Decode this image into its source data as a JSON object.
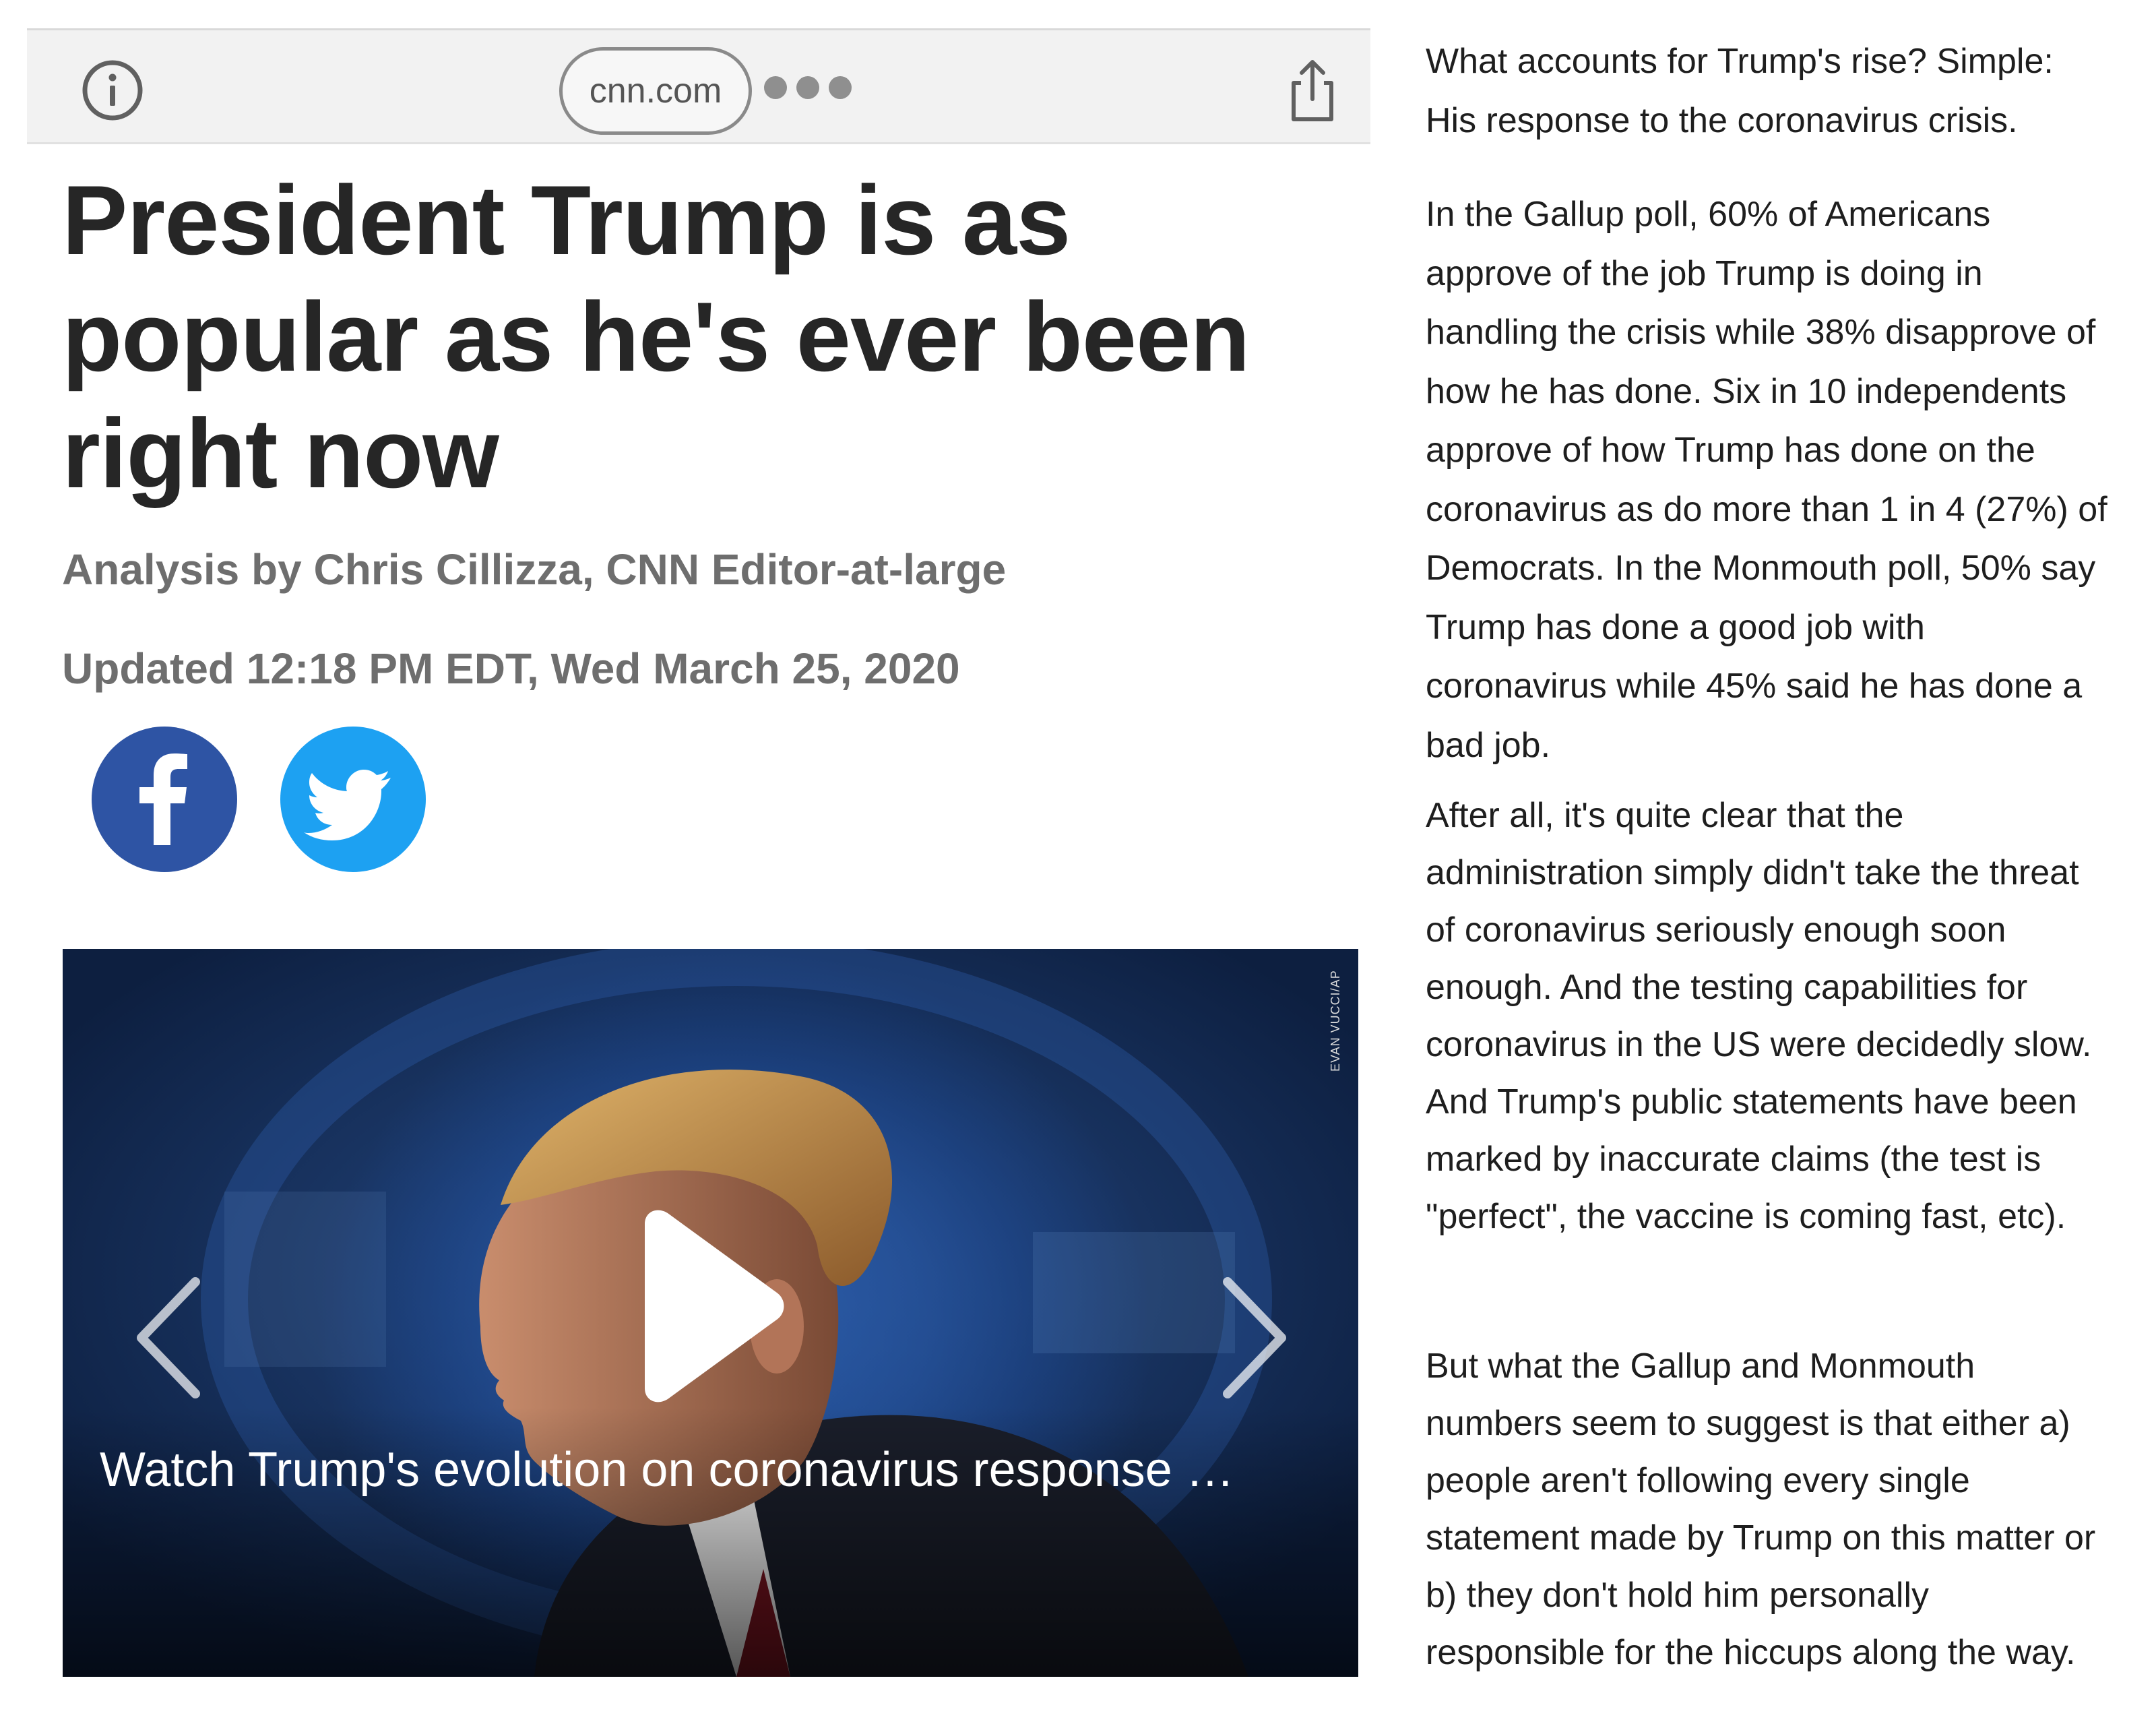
{
  "browser": {
    "url": "cnn.com",
    "icons": {
      "info": "info-icon",
      "more": "more-dots-icon",
      "share": "share-icon"
    }
  },
  "article": {
    "headline_lines": [
      "President Trump is as",
      "popular as he's ever been",
      "right now"
    ],
    "byline": "Analysis by Chris Cillizza, CNN Editor-at-large",
    "updated": "Updated 12:18 PM EDT, Wed March 25, 2020",
    "social": [
      {
        "icon": "facebook-icon",
        "color": "#2e54a4"
      },
      {
        "icon": "twitter-icon",
        "color": "#1da1f2"
      }
    ],
    "video": {
      "caption": "Watch Trump's evolution on coronavirus response …",
      "credit": "EVAN VUCCI/AP"
    }
  },
  "side_paragraphs": [
    "What accounts for Trump's rise? Simple: His response to the coronavirus crisis.",
    "In the Gallup poll, 60% of Americans approve of the job Trump is doing in handling the crisis while 38% disapprove of how he has done. Six in 10 independents approve of how Trump has done on the coronavirus as do more than 1 in 4 (27%) of Democrats. In the Monmouth poll, 50% say Trump has done a good job with coronavirus while 45% said he has done a bad job.",
    "After all, it's quite clear that the administration simply didn't take the threat of coronavirus seriously enough soon enough. And the testing capabilities for coronavirus in the US were decidedly slow. And Trump's public statements have been marked by inaccurate claims (the test is \"perfect\", the vaccine is coming fast, etc).",
    "But what the Gallup and Monmouth numbers seem to suggest is that either a) people aren't following every single statement made by Trump on this matter or b) they don't hold him personally responsible for the hiccups along the way."
  ]
}
